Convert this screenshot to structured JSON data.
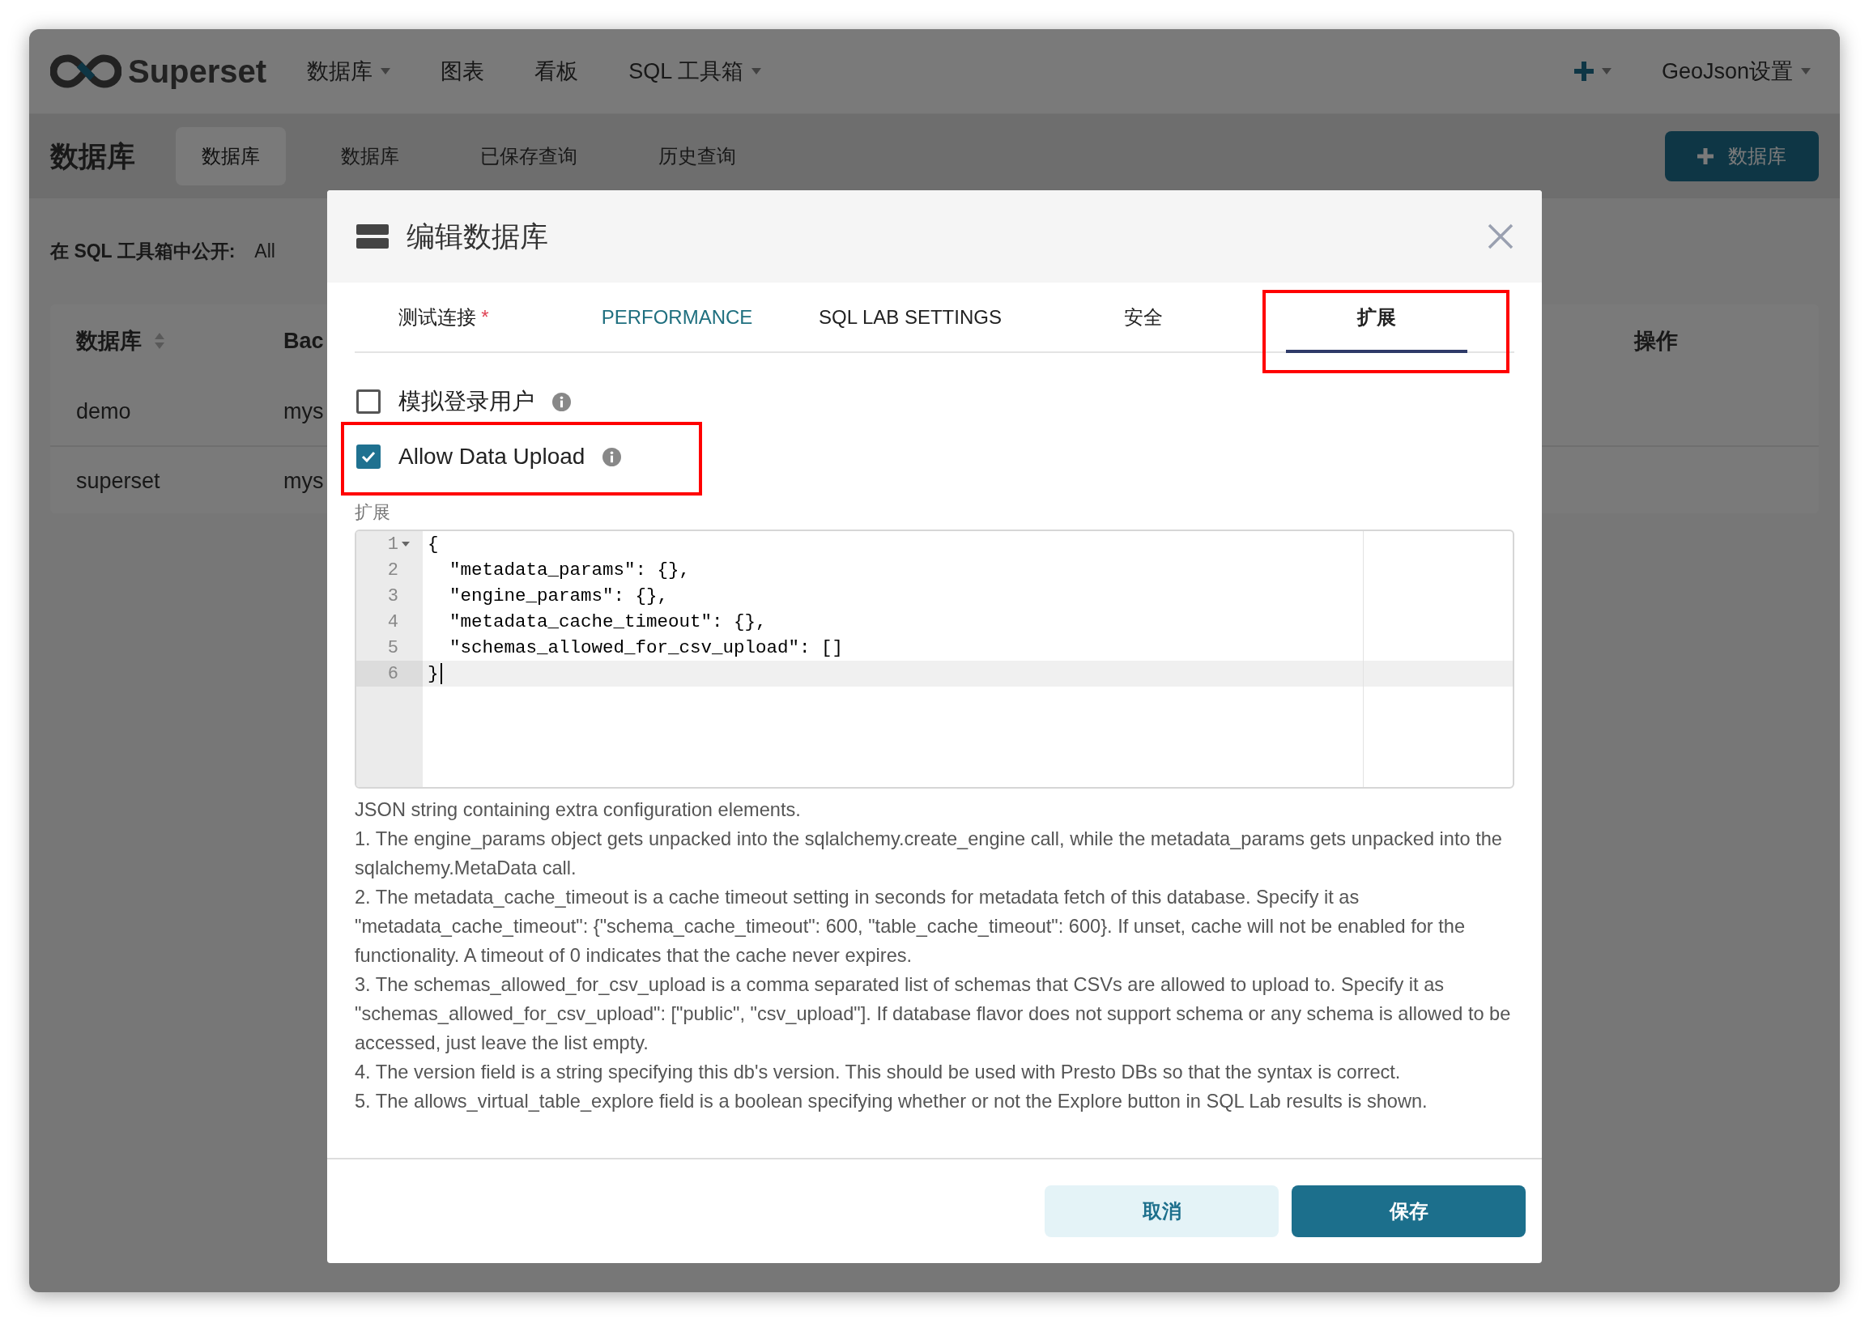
{
  "navbar": {
    "brand": "Superset",
    "menu": [
      {
        "label": "数据库",
        "kind": "dropdown"
      },
      {
        "label": "图表",
        "kind": "link"
      },
      {
        "label": "看板",
        "kind": "link"
      },
      {
        "label": "SQL 工具箱",
        "kind": "dropdown"
      }
    ],
    "user_menu": {
      "label": "GeoJson设置"
    }
  },
  "subheader": {
    "title": "数据库",
    "tabs": [
      {
        "label": "数据库",
        "selected": true
      },
      {
        "label": "数据库",
        "selected": false
      },
      {
        "label": "已保存查询",
        "selected": false
      },
      {
        "label": "历史查询",
        "selected": false
      }
    ],
    "add_button": {
      "label": "数据库"
    }
  },
  "filter": {
    "label": "在 SQL 工具箱中公开:",
    "value": "All"
  },
  "table": {
    "columns": [
      {
        "label": "数据库",
        "sortable": true
      },
      {
        "label": "Bac"
      },
      {
        "label": "操作"
      }
    ],
    "rows": [
      [
        "demo",
        "mys"
      ],
      [
        "superset",
        "mys"
      ]
    ]
  },
  "modal": {
    "title": "编辑数据库",
    "tabs": [
      {
        "label": "测试连接",
        "required_mark": "*",
        "selected": false,
        "hovered": false,
        "highlighted": false
      },
      {
        "label": "PERFORMANCE",
        "selected": false,
        "hovered": true,
        "highlighted": false
      },
      {
        "label": "SQL LAB SETTINGS",
        "selected": false,
        "hovered": false,
        "highlighted": false
      },
      {
        "label": "安全",
        "selected": false,
        "hovered": false,
        "highlighted": false
      },
      {
        "label": "扩展",
        "selected": true,
        "hovered": false,
        "highlighted": true
      }
    ],
    "options": [
      {
        "label": "模拟登录用户",
        "checked": false
      },
      {
        "label": "Allow Data Upload",
        "checked": true,
        "highlighted": true
      }
    ],
    "editor_label": "扩展",
    "editor_lines": [
      {
        "number": "1",
        "text": "{",
        "foldable": true,
        "active": false
      },
      {
        "number": "2",
        "text": "  \"metadata_params\": {},",
        "active": false
      },
      {
        "number": "3",
        "text": "  \"engine_params\": {},",
        "active": false
      },
      {
        "number": "4",
        "text": "  \"metadata_cache_timeout\": {},",
        "active": false
      },
      {
        "number": "5",
        "text": "  \"schemas_allowed_for_csv_upload\": []",
        "active": false
      },
      {
        "number": "6",
        "text": "}",
        "active": true
      }
    ],
    "description": [
      "JSON string containing extra configuration elements.",
      "1. The engine_params object gets unpacked into the sqlalchemy.create_engine call, while the metadata_params gets unpacked into the sqlalchemy.MetaData call.",
      "2. The metadata_cache_timeout is a cache timeout setting in seconds for metadata fetch of this database. Specify it as \"metadata_cache_timeout\": {\"schema_cache_timeout\": 600, \"table_cache_timeout\": 600}. If unset, cache will not be enabled for the functionality. A timeout of 0 indicates that the cache never expires.",
      "3. The schemas_allowed_for_csv_upload is a comma separated list of schemas that CSVs are allowed to upload to. Specify it as \"schemas_allowed_for_csv_upload\": [\"public\", \"csv_upload\"]. If database flavor does not support schema or any schema is allowed to be accessed, just leave the list empty.",
      "4. The version field is a string specifying this db's version. This should be used with Presto DBs so that the syntax is correct.",
      "5. The allows_virtual_table_explore field is a boolean specifying whether or not the Explore button in SQL Lab results is shown."
    ],
    "buttons": [
      {
        "label": "取消",
        "kind": "secondary"
      },
      {
        "label": "保存",
        "kind": "primary"
      }
    ]
  }
}
